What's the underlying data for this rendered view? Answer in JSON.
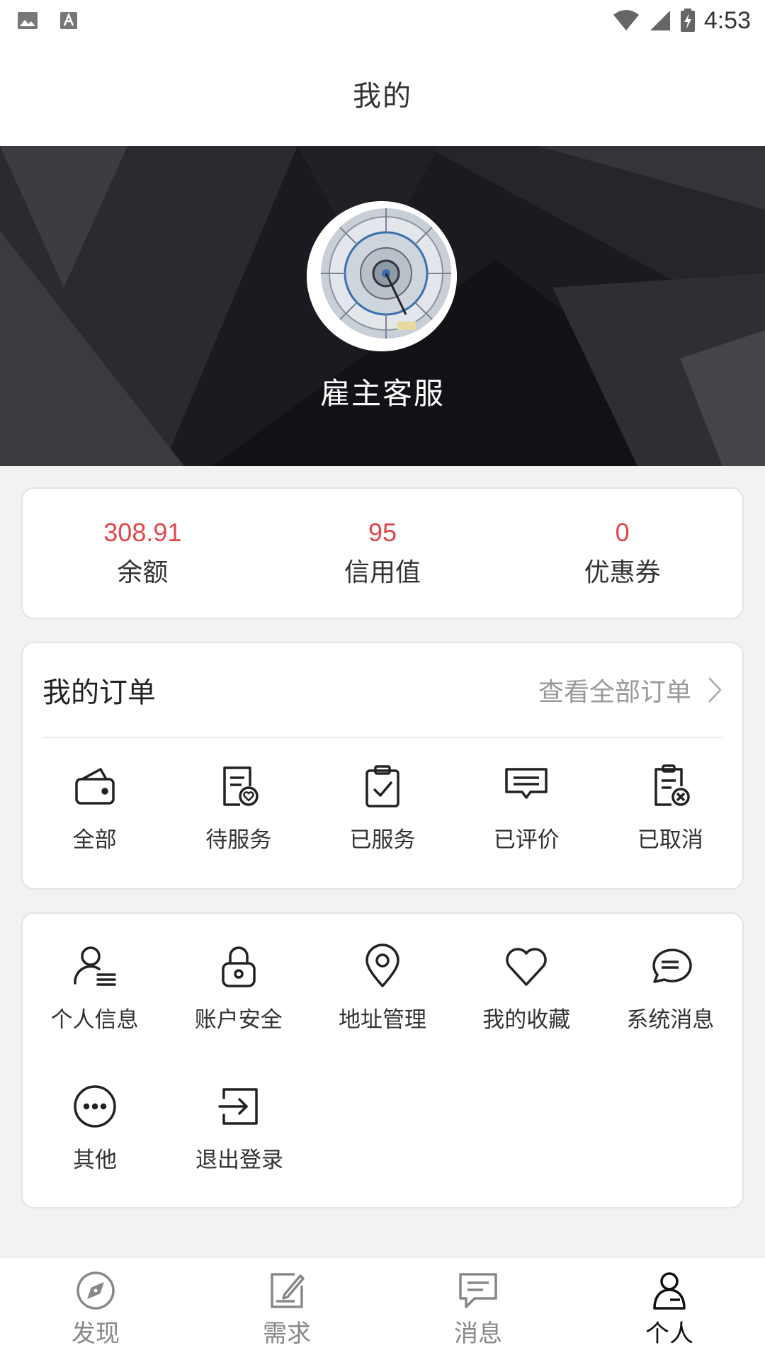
{
  "status_bar": {
    "time": "4:53",
    "left_icons": [
      "image-icon",
      "text-a-icon"
    ],
    "right_icons": [
      "wifi-icon",
      "signal-icon",
      "battery-icon"
    ]
  },
  "header": {
    "title": "我的"
  },
  "profile": {
    "name": "雇主客服",
    "avatar": "avatar-image"
  },
  "stats": [
    {
      "value": "308.91",
      "label": "余额"
    },
    {
      "value": "95",
      "label": "信用值"
    },
    {
      "value": "0",
      "label": "优惠券"
    }
  ],
  "orders": {
    "title": "我的订单",
    "more_label": "查看全部订单",
    "items": [
      {
        "label": "全部",
        "icon": "wallet-icon"
      },
      {
        "label": "待服务",
        "icon": "doc-heart-icon"
      },
      {
        "label": "已服务",
        "icon": "clipboard-check-icon"
      },
      {
        "label": "已评价",
        "icon": "comment-icon"
      },
      {
        "label": "已取消",
        "icon": "doc-cancel-icon"
      }
    ]
  },
  "menu": {
    "items": [
      {
        "label": "个人信息",
        "icon": "user-info-icon"
      },
      {
        "label": "账户安全",
        "icon": "lock-icon"
      },
      {
        "label": "地址管理",
        "icon": "location-pin-icon"
      },
      {
        "label": "我的收藏",
        "icon": "heart-icon"
      },
      {
        "label": "系统消息",
        "icon": "chat-bubble-icon"
      },
      {
        "label": "其他",
        "icon": "more-dots-icon"
      },
      {
        "label": "退出登录",
        "icon": "logout-icon"
      }
    ]
  },
  "bottom_nav": {
    "items": [
      {
        "label": "发现",
        "icon": "compass-icon",
        "active": false
      },
      {
        "label": "需求",
        "icon": "edit-note-icon",
        "active": false
      },
      {
        "label": "消息",
        "icon": "message-icon",
        "active": false
      },
      {
        "label": "个人",
        "icon": "person-icon",
        "active": true
      }
    ]
  },
  "colors": {
    "accent_red": "#e0474c",
    "header_bg": "#17171d",
    "page_bg": "#f2f2f2"
  }
}
